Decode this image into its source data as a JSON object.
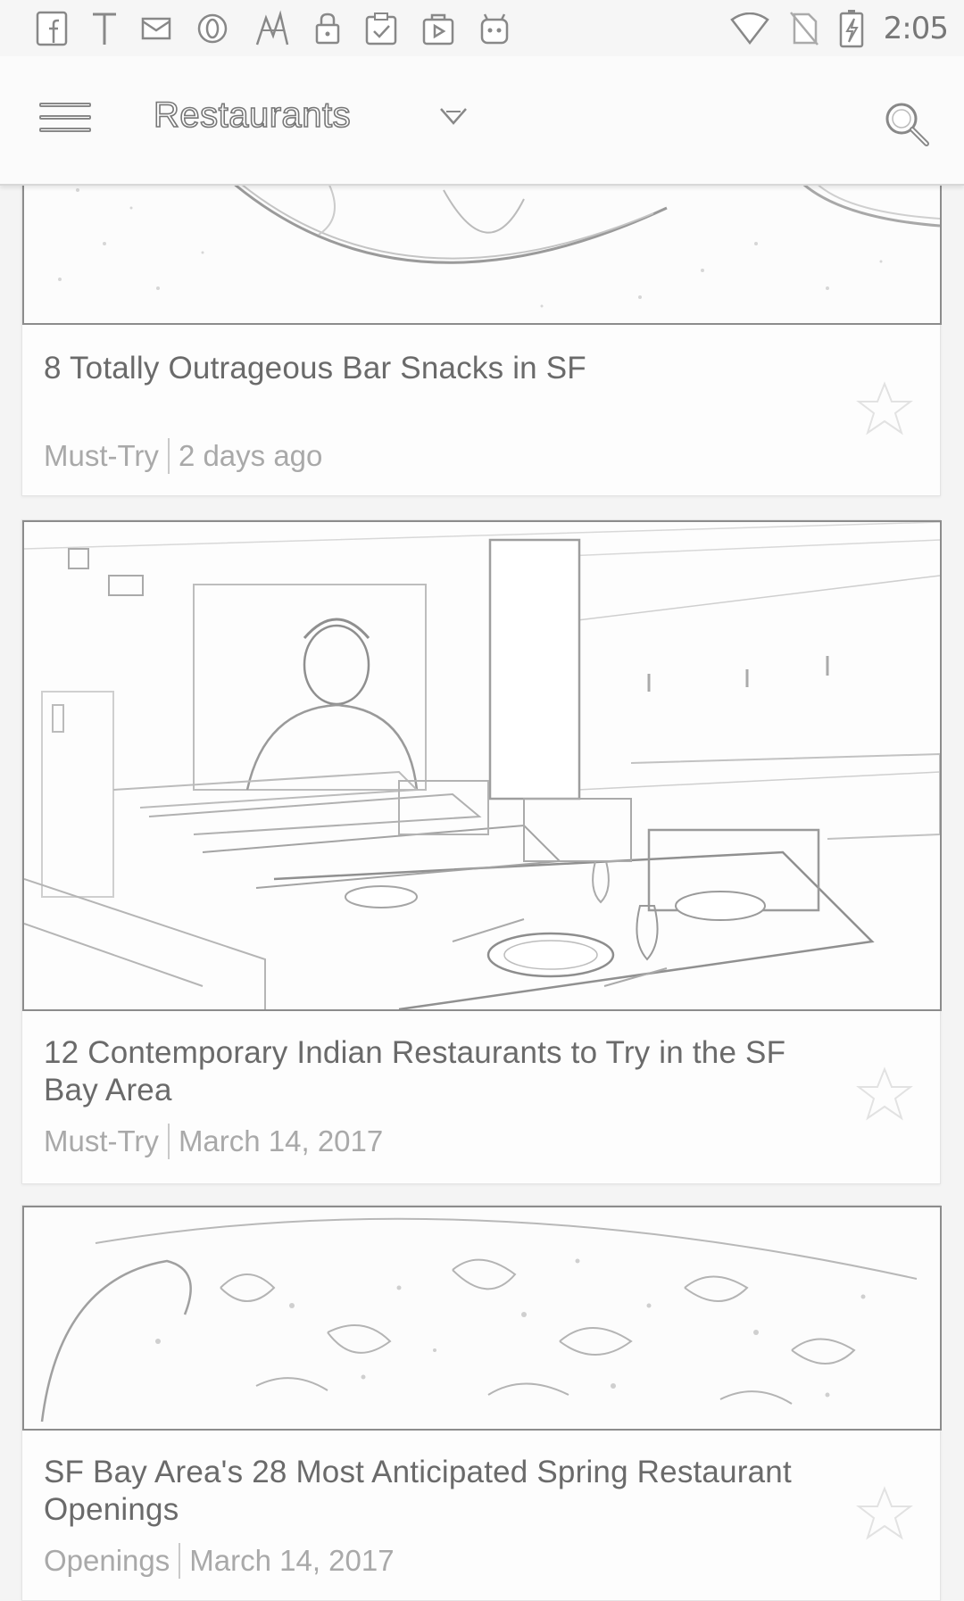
{
  "status_bar": {
    "time": "2:05",
    "left_icons": [
      "facebook-icon",
      "text-t-icon",
      "mail-icon",
      "opera-icon",
      "fancy-logo-icon",
      "lock-icon",
      "clipboard-check-icon",
      "media-bag-icon",
      "robot-icon"
    ],
    "right_icons": [
      "wifi-icon",
      "no-sim-icon",
      "battery-charging-icon"
    ]
  },
  "app_bar": {
    "title": "Restaurants",
    "menu_icon": "hamburger-menu-icon",
    "dropdown_icon": "chevron-down-icon",
    "search_icon": "search-icon"
  },
  "articles": [
    {
      "title": "8 Totally Outrageous Bar Snacks in SF",
      "category": "Must-Try",
      "date": "2 days ago",
      "image": "bar-snacks-plate-photo"
    },
    {
      "title": "12 Contemporary Indian Restaurants to Try in the SF Bay Area",
      "category": "Must-Try",
      "date": "March 14, 2017",
      "image": "indian-restaurant-dining-room-photo"
    },
    {
      "title": "SF Bay Area's 28 Most Anticipated Spring Restaurant Openings",
      "category": "Openings",
      "date": "March 14, 2017",
      "image": "food-dish-closeup-photo"
    }
  ],
  "colors": {
    "background": "#f4f4f4",
    "card": "#fdfdfd",
    "title_text": "#6a6a6a",
    "meta_text": "#a9a9a9"
  }
}
